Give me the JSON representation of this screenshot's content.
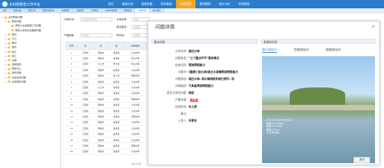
{
  "app": {
    "title": "水利部督查工作平台"
  },
  "nav": [
    "首页",
    "督查计划",
    "督查准备",
    "现场督查",
    "问题管理",
    "整改跟踪",
    "统计分析",
    "系统管理"
  ],
  "nav_active_index": 4,
  "tabs": [
    "首页",
    "问题台账",
    "督查计划",
    "督查问题列表",
    "水库督查",
    "工程督查",
    "工作督查",
    "小型水库督查",
    "问题整改",
    "水库问题",
    "统计报表"
  ],
  "tab_active_index": 9,
  "tree": [
    {
      "label": "水利督查问题",
      "depth": 0,
      "expand": "▾"
    },
    {
      "label": "督查问题",
      "depth": 1,
      "expand": "▾"
    },
    {
      "label": "督查小水库管理工作问题",
      "depth": 2,
      "expand": ""
    },
    {
      "label": "督查小水库安全管理问题",
      "depth": 2,
      "expand": ""
    },
    {
      "label": "海河",
      "depth": 1,
      "expand": "▸"
    },
    {
      "label": "长江",
      "depth": 1,
      "expand": "▸"
    },
    {
      "label": "黄河",
      "depth": 1,
      "expand": "▸"
    },
    {
      "label": "淮河",
      "depth": 1,
      "expand": "▸"
    },
    {
      "label": "松辽",
      "depth": 1,
      "expand": "▸"
    },
    {
      "label": "珠江",
      "depth": 1,
      "expand": "▸"
    },
    {
      "label": "太湖",
      "depth": 1,
      "expand": "▸"
    },
    {
      "label": "流域机构",
      "depth": 1,
      "expand": "▸"
    },
    {
      "label": "督查中心",
      "depth": 1,
      "expand": "▸"
    },
    {
      "label": "其他问题",
      "depth": 1,
      "expand": "▸"
    },
    {
      "label": "水库检查问题",
      "depth": 1,
      "expand": "▸"
    },
    {
      "label": "水库督查问题",
      "depth": 1,
      "expand": "▸"
    }
  ],
  "list": {
    "fields": [
      {
        "label": "行政区划:",
        "placeholder": "请选择行政区划"
      },
      {
        "label": "水库名称:",
        "placeholder": "请输入"
      },
      {
        "label": "严重程度:",
        "placeholder": "请选择"
      },
      {
        "label": "是否整改:",
        "placeholder": "请选择"
      },
      {
        "label": "所在地:",
        "placeholder": "请选择"
      }
    ],
    "columns": [
      "序号",
      "省",
      "市",
      "县",
      "水库名称"
    ],
    "rows": [
      [
        "1",
        "江西省",
        "南昌市",
        "进贤县",
        "大龙水库"
      ],
      [
        "2",
        "江西省",
        "南昌市",
        "新建区",
        "石头水库"
      ],
      [
        "3",
        "江西省",
        "九江市",
        "修水县",
        "青山水库"
      ],
      [
        "4",
        "江西省",
        "南昌市",
        "进贤县",
        "大龙水库"
      ],
      [
        "5",
        "江西省",
        "南昌市",
        "安义县",
        "围圆水库"
      ],
      [
        "6",
        "江西省",
        "南昌市",
        "进贤县",
        "大龙水库"
      ],
      [
        "7",
        "江西省",
        "九江市",
        "永修县",
        "大龙水库"
      ],
      [
        "8",
        "江西省",
        "南昌市",
        "进贤县",
        "大龙水库"
      ],
      [
        "9",
        "江西省",
        "南昌市",
        "新建区",
        "围圆水库"
      ],
      [
        "10",
        "江西省",
        "南昌市",
        "进贤县",
        "大龙水库"
      ],
      [
        "11",
        "江西省",
        "南昌市",
        "进贤县",
        "大龙水库"
      ],
      [
        "12",
        "江西省",
        "南昌市",
        "进贤县",
        "双港水库"
      ],
      [
        "13",
        "江西省",
        "南昌市",
        "进贤县",
        "大龙水库"
      ],
      [
        "14",
        "江西省",
        "南昌市",
        "进贤县",
        "大龙水库"
      ],
      [
        "15",
        "江西省",
        "南昌市",
        "进贤县",
        "大龙水库"
      ],
      [
        "16",
        "江西省",
        "南昌市",
        "进贤县",
        "大龙水库"
      ],
      [
        "17",
        "江西省",
        "南昌市",
        "进贤县",
        "围圆水库"
      ],
      [
        "18",
        "江西省",
        "南昌市",
        "进贤县",
        "大龙水库"
      ]
    ],
    "pager": "共 156 条"
  },
  "modal": {
    "title": "问题详情",
    "close": "×",
    "basic": "基本信息",
    "media": "多媒体信息",
    "info": [
      {
        "k": "水库名称:",
        "v": "园庄水库"
      },
      {
        "k": "问题类型:",
        "v": "\"三个重点环节\"落实情况"
      },
      {
        "k": "检查项目:",
        "v": "预测预报能力"
      },
      {
        "k": "问题项:",
        "v": "(重要小型水库)缺乏水雨情预测预报能力"
      },
      {
        "k": "问题描述:",
        "v": "园庄水库, 雨水情测报系统已损坏, 现"
      },
      {
        "k": "详细描述:",
        "v": "不具备预测预报能力"
      },
      {
        "k": "是否为典型问题:",
        "v": "典型"
      },
      {
        "k": "严重程度:",
        "v": "",
        "badge": "严重"
      },
      {
        "k": "处理状态:",
        "v": "未上报"
      },
      {
        "k": "备注:",
        "v": ""
      },
      {
        "k": "上报人:",
        "v": "孙爱安"
      }
    ],
    "media_tabs": [
      "图片资料(1)",
      "音频资料(0)",
      "视频资料(0)"
    ],
    "photo_stamp": [
      "2021-05-26 09:36:27",
      "经度:116.4852",
      "纬度:39.9182",
      "海拔:52.6m",
      "方位角:西北"
    ],
    "close_button": "关闭"
  },
  "colors": {
    "header": "#2b7ccb",
    "active_nav": "#f5a623",
    "badge": "#f06a6a"
  }
}
